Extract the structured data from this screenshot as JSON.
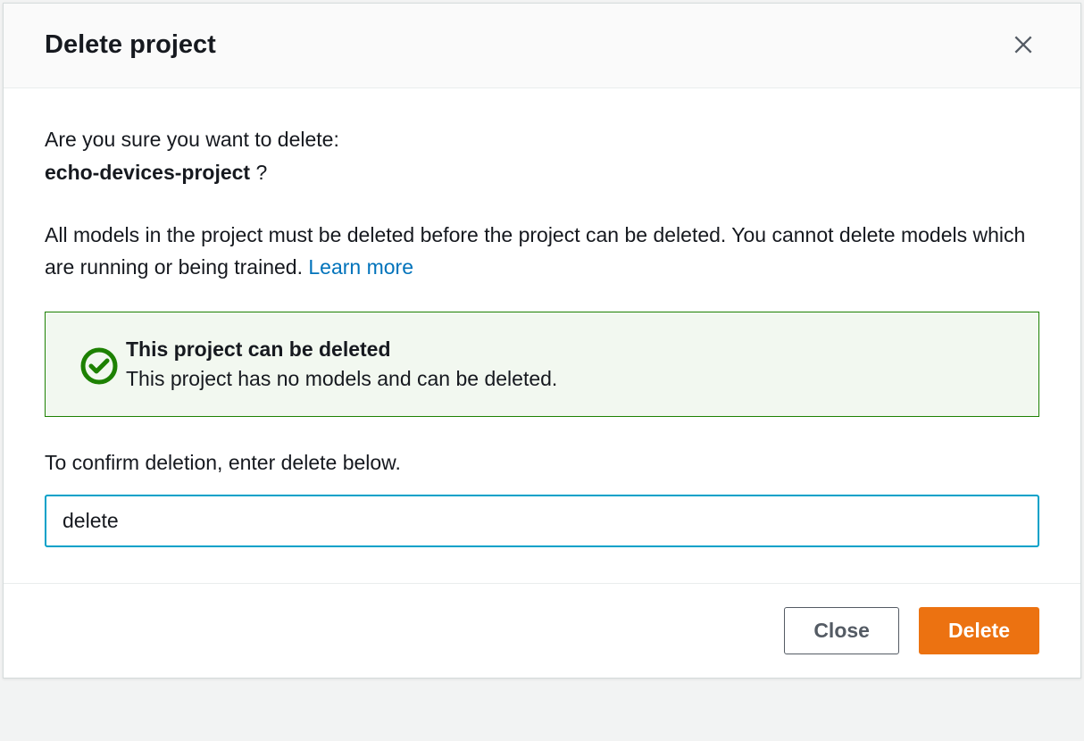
{
  "modal": {
    "title": "Delete project",
    "question": "Are you sure you want to delete:",
    "project_name": "echo-devices-project",
    "question_suffix": "?",
    "warning_text": "All models in the project must be deleted before the project can be deleted. You cannot delete models which are running or being trained. ",
    "learn_more": "Learn more",
    "status": {
      "title": "This project can be deleted",
      "desc": "This project has no models and can be deleted."
    },
    "input_label": "To confirm deletion, enter delete below.",
    "input_value": "delete",
    "buttons": {
      "close": "Close",
      "delete": "Delete"
    }
  }
}
